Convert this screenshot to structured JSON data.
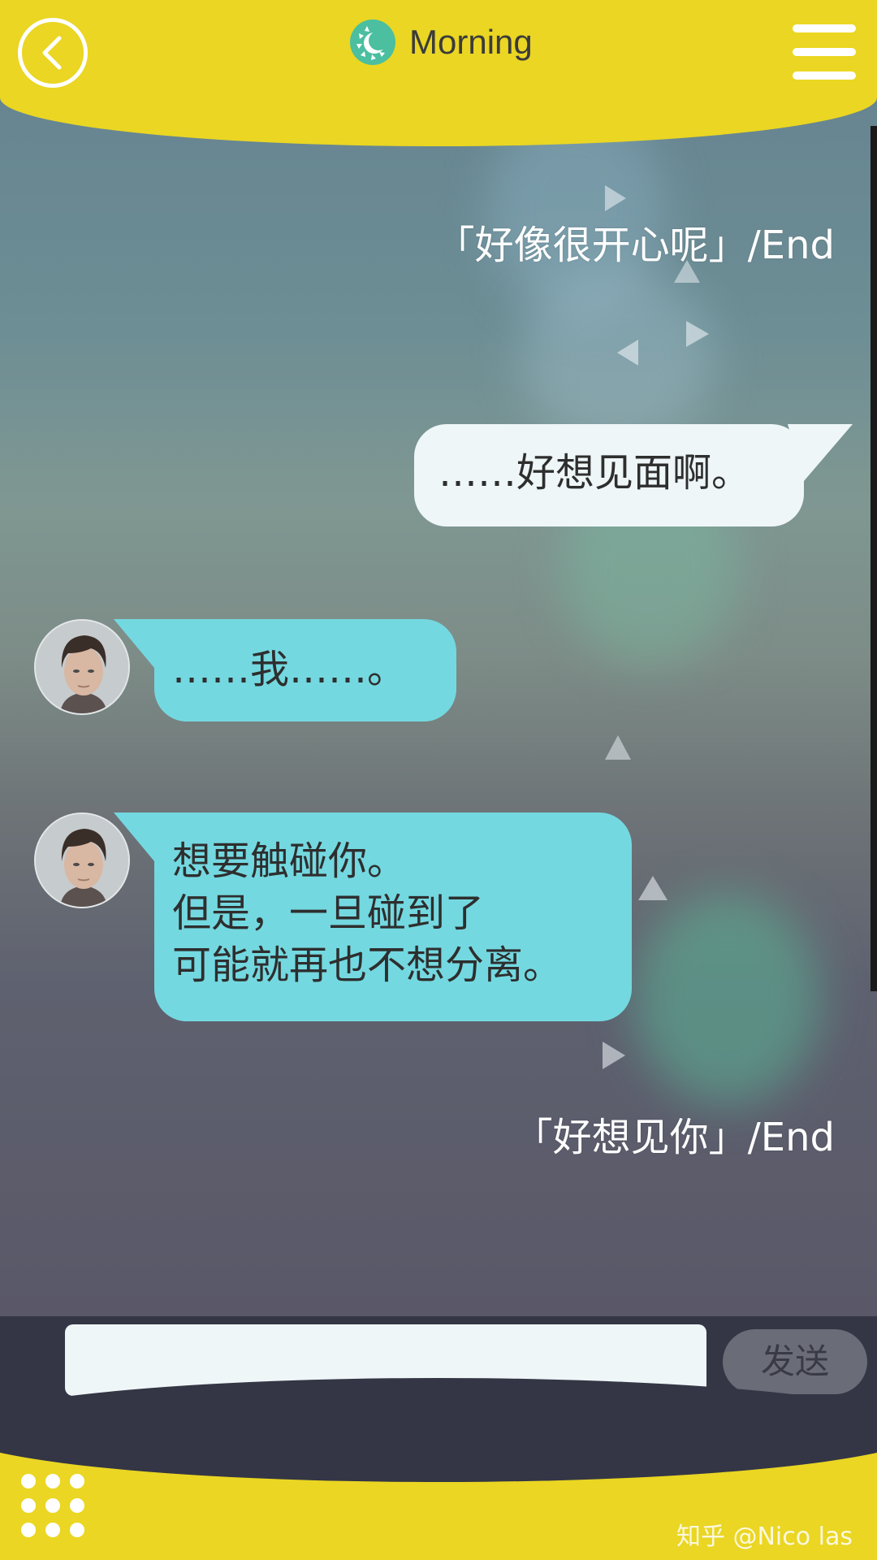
{
  "header": {
    "title": "Morning",
    "back_icon": "chevron-left-icon",
    "weather_icon": "sun-moon-icon",
    "menu_icon": "hamburger-menu-icon",
    "bar_color": "#ead623"
  },
  "messages": [
    {
      "type": "system",
      "text": "「好像很开心呢」/End"
    },
    {
      "type": "outgoing",
      "text": "……好想见面啊。"
    },
    {
      "type": "incoming",
      "text": "……我……。"
    },
    {
      "type": "incoming",
      "lines": [
        "想要触碰你。",
        "但是，一旦碰到了",
        "可能就再也不想分离。"
      ]
    },
    {
      "type": "system",
      "text": "「好想见你」/End"
    }
  ],
  "input": {
    "placeholder": "",
    "send_label": "发送"
  },
  "footer": {
    "grid_icon": "apps-grid-icon",
    "watermark": "知乎 @Nico las"
  },
  "colors": {
    "incoming_bubble": "#74d8e0",
    "outgoing_bubble": "#eef6f8",
    "input_bar": "#343645"
  }
}
